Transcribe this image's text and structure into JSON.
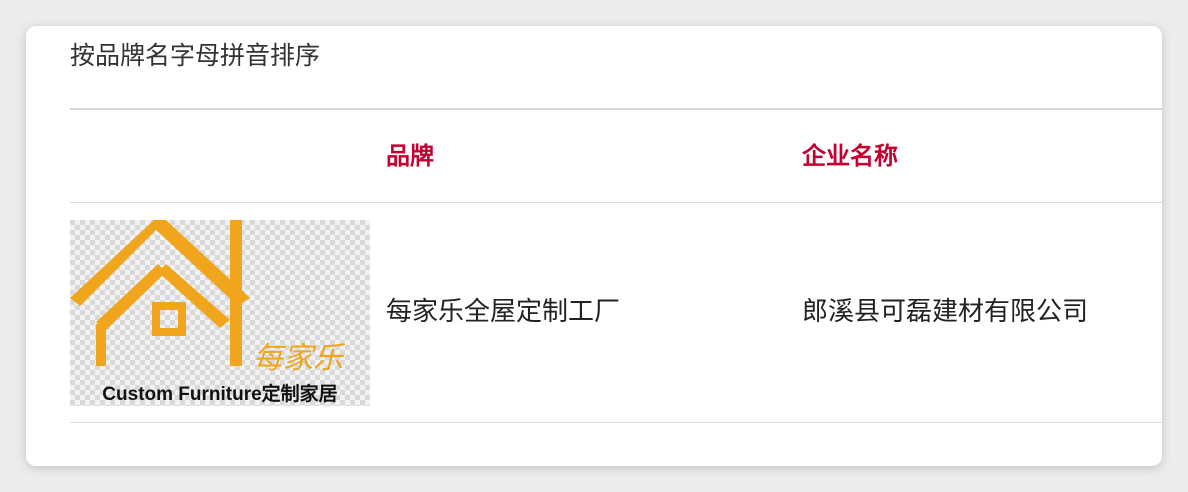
{
  "section": {
    "sort_label": "按品牌名字母拼音排序"
  },
  "table": {
    "header_color": "#c3002f",
    "columns": [
      "品牌",
      "企业名称"
    ],
    "rows": [
      {
        "logo": {
          "brand_text": "每家乐",
          "tagline": "Custom Furniture定制家居",
          "accent_color": "#f0a51c",
          "icon": "house-icon"
        },
        "brand": "每家乐全屋定制工厂",
        "company": "郎溪县可磊建材有限公司"
      }
    ]
  }
}
